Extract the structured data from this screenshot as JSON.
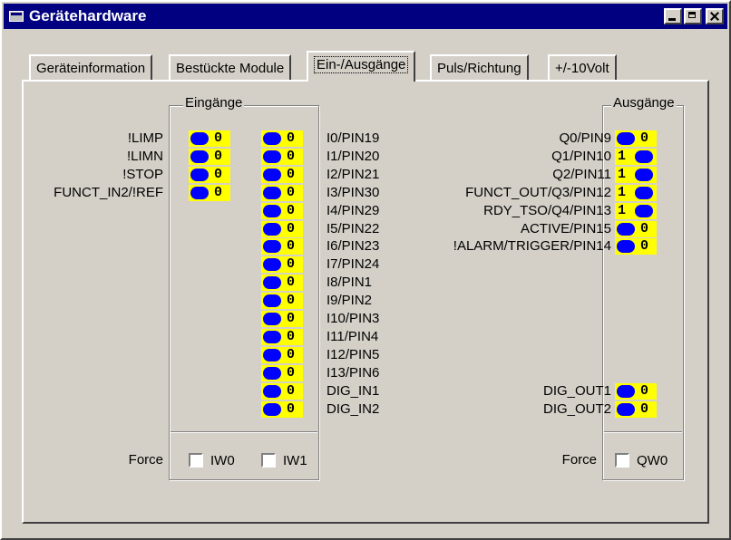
{
  "window": {
    "title": "Gerätehardware"
  },
  "tabs": [
    "Geräteinformation",
    "Bestückte Module",
    "Ein-/Ausgänge",
    "Puls/Richtung",
    "+/-10Volt"
  ],
  "inputs": {
    "group_label": "Eingänge",
    "left": [
      {
        "label": "!LIMP",
        "value": "0"
      },
      {
        "label": "!LIMN",
        "value": "0"
      },
      {
        "label": "!STOP",
        "value": "0"
      },
      {
        "label": "FUNCT_IN2/!REF",
        "value": "0"
      }
    ],
    "right": [
      {
        "label": "I0/PIN19",
        "value": "0"
      },
      {
        "label": "I1/PIN20",
        "value": "0"
      },
      {
        "label": "I2/PIN21",
        "value": "0"
      },
      {
        "label": "I3/PIN30",
        "value": "0"
      },
      {
        "label": "I4/PIN29",
        "value": "0"
      },
      {
        "label": "I5/PIN22",
        "value": "0"
      },
      {
        "label": "I6/PIN23",
        "value": "0"
      },
      {
        "label": "I7/PIN24",
        "value": "0"
      },
      {
        "label": "I8/PIN1",
        "value": "0"
      },
      {
        "label": "I9/PIN2",
        "value": "0"
      },
      {
        "label": "I10/PIN3",
        "value": "0"
      },
      {
        "label": "I11/PIN4",
        "value": "0"
      },
      {
        "label": "I12/PIN5",
        "value": "0"
      },
      {
        "label": "I13/PIN6",
        "value": "0"
      },
      {
        "label": "DIG_IN1",
        "value": "0"
      },
      {
        "label": "DIG_IN2",
        "value": "0"
      }
    ],
    "force_label": "Force",
    "force_checks": [
      {
        "label": "IW0",
        "checked": false
      },
      {
        "label": "IW1",
        "checked": false
      }
    ]
  },
  "outputs": {
    "group_label": "Ausgänge",
    "items": [
      {
        "label": "Q0/PIN9",
        "value": "0"
      },
      {
        "label": "Q1/PIN10",
        "value": "1"
      },
      {
        "label": "Q2/PIN11",
        "value": "1"
      },
      {
        "label": "FUNCT_OUT/Q3/PIN12",
        "value": "1"
      },
      {
        "label": "RDY_TSO/Q4/PIN13",
        "value": "1"
      },
      {
        "label": "ACTIVE/PIN15",
        "value": "0"
      },
      {
        "label": "!ALARM/TRIGGER/PIN14",
        "value": "0"
      }
    ],
    "dig": [
      {
        "label": "DIG_OUT1",
        "value": "0"
      },
      {
        "label": "DIG_OUT2",
        "value": "0"
      }
    ],
    "force_label": "Force",
    "force_checks": [
      {
        "label": "QW0",
        "checked": false
      }
    ]
  },
  "colors": {
    "title_bar": "#000080",
    "led_bg": "#ffff00",
    "led_dot": "#0000ff",
    "dialog_bg": "#d4d0c8"
  }
}
